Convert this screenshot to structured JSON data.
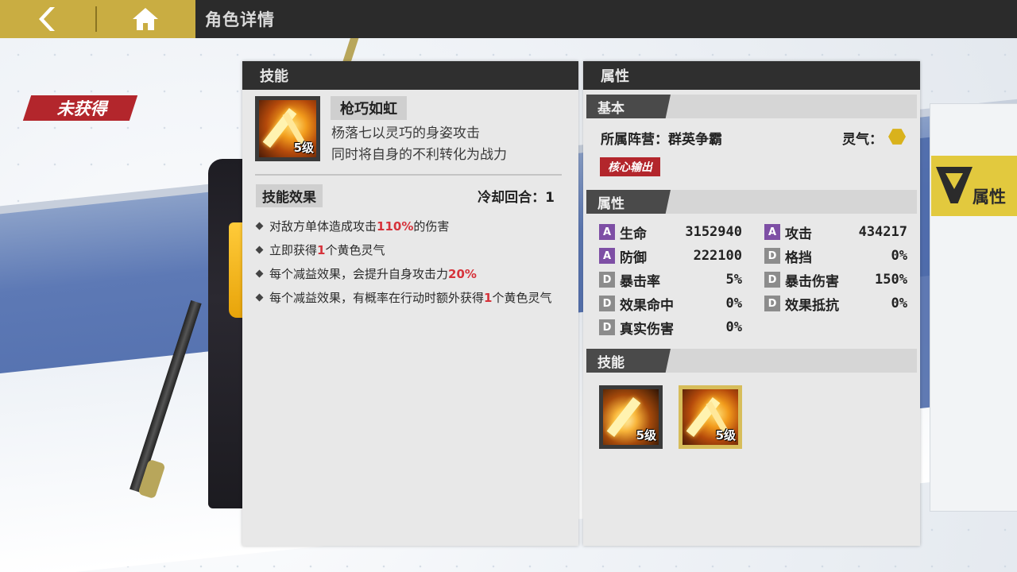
{
  "header": {
    "title": "角色详情"
  },
  "status_tag": "未获得",
  "skills_panel": {
    "title": "技能",
    "skill": {
      "name": "枪巧如虹",
      "level": "5级",
      "desc_line1": "杨落七以灵巧的身姿攻击",
      "desc_line2": "同时将自身的不利转化为战力"
    },
    "effects_label": "技能效果",
    "cooldown": "冷却回合：1",
    "effects": [
      {
        "pre": "对敌方单体造成攻击",
        "hl": "110%",
        "post": "的伤害"
      },
      {
        "pre": "立即获得",
        "hl": "1",
        "post": "个黄色灵气"
      },
      {
        "pre": "每个减益效果，会提升自身攻击力",
        "hl": "20%",
        "post": ""
      },
      {
        "pre": "每个减益效果，有概率在行动时额外获得",
        "hl": "1",
        "post": "个黄色灵气"
      }
    ]
  },
  "attr_panel": {
    "title": "属性",
    "basic_label": "基本",
    "faction": "所属阵营：群英争霸",
    "aura_label": "灵气：",
    "role_tag": "核心输出",
    "attr_label": "属性",
    "stats": [
      {
        "grade": "A",
        "name": "生命",
        "value": "3152940"
      },
      {
        "grade": "A",
        "name": "攻击",
        "value": "434217"
      },
      {
        "grade": "A",
        "name": "防御",
        "value": "222100"
      },
      {
        "grade": "D",
        "name": "格挡",
        "value": "0%"
      },
      {
        "grade": "D",
        "name": "暴击率",
        "value": "5%"
      },
      {
        "grade": "D",
        "name": "暴击伤害",
        "value": "150%"
      },
      {
        "grade": "D",
        "name": "效果命中",
        "value": "0%"
      },
      {
        "grade": "D",
        "name": "效果抵抗",
        "value": "0%"
      },
      {
        "grade": "D",
        "name": "真实伤害",
        "value": "0%"
      }
    ],
    "skills_label": "技能",
    "skill_slots": [
      {
        "level": "5级"
      },
      {
        "level": "5级"
      }
    ]
  },
  "side_tab": {
    "label": "属性"
  },
  "icons": {
    "back": "back-arrow-icon",
    "home": "home-icon"
  },
  "colors": {
    "accent_yellow": "#c9ad42",
    "highlight_red": "#d6333b",
    "grade_a": "#7e4fa5"
  }
}
